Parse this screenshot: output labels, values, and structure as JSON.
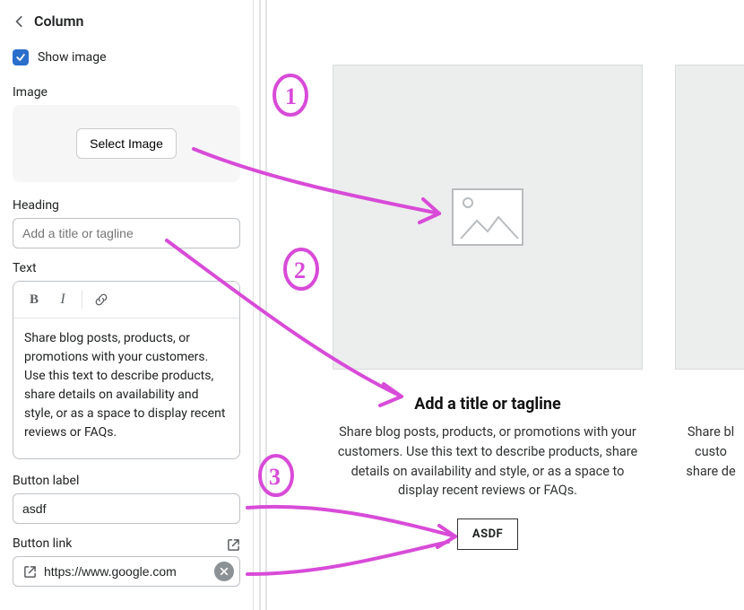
{
  "panel": {
    "title": "Column",
    "show_image": {
      "label": "Show image",
      "checked": true
    },
    "image": {
      "label": "Image",
      "select_button": "Select Image"
    },
    "heading": {
      "label": "Heading",
      "placeholder": "Add a title or tagline",
      "value": ""
    },
    "text": {
      "label": "Text",
      "body": "Share blog posts, products, or promotions with your customers. Use this text to describe products, share details on availability and style, or as a space to display recent reviews or FAQs."
    },
    "button_label": {
      "label": "Button label",
      "value": "asdf"
    },
    "button_link": {
      "label": "Button link",
      "value": "https://www.google.com"
    }
  },
  "preview": {
    "cards": [
      {
        "heading": "Add a title or tagline",
        "text": "Share blog posts, products, or promotions with your customers. Use this text to describe products, share details on availability and style, or as a space to display recent reviews or FAQs.",
        "button": "ASDF"
      },
      {
        "heading": "",
        "text": "Share blog posts, products, or promotions with your customers. Use this text to describe products, share details on availability and style, or as a space to display recent reviews or FAQs.",
        "button": ""
      }
    ],
    "card2_lines": [
      "Share bl",
      "custo",
      "share de"
    ]
  },
  "annotations": {
    "1": "1",
    "2": "2",
    "3": "3"
  }
}
